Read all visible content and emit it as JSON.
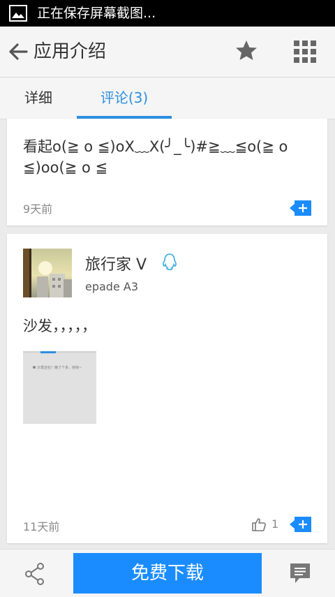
{
  "status_bar": {
    "notification_text": "正在保存屏幕截图..."
  },
  "app_bar": {
    "title": "应用介绍"
  },
  "tabs": [
    {
      "label": "详细",
      "active": false
    },
    {
      "label": "评论(3)",
      "active": true
    }
  ],
  "comments": [
    {
      "text_lines": [
        "看起o(≧ o ≦)oX﹏X(╯_╰)#≧﹏≦o(≧ o",
        "≦)oo(≧ o ≦"
      ],
      "time": "9天前"
    },
    {
      "username": "旅行家 V",
      "device": "epade A3",
      "text": "沙发，，，，，",
      "attachment_text": "沙发还在！晚了个多，快快~",
      "time": "11天前",
      "likes": "1"
    }
  ],
  "bottom_bar": {
    "download_label": "免费下载"
  },
  "colors": {
    "accent": "#2d8fe0",
    "download_button": "#1a8cff",
    "qq_blue": "#48b1e8"
  }
}
